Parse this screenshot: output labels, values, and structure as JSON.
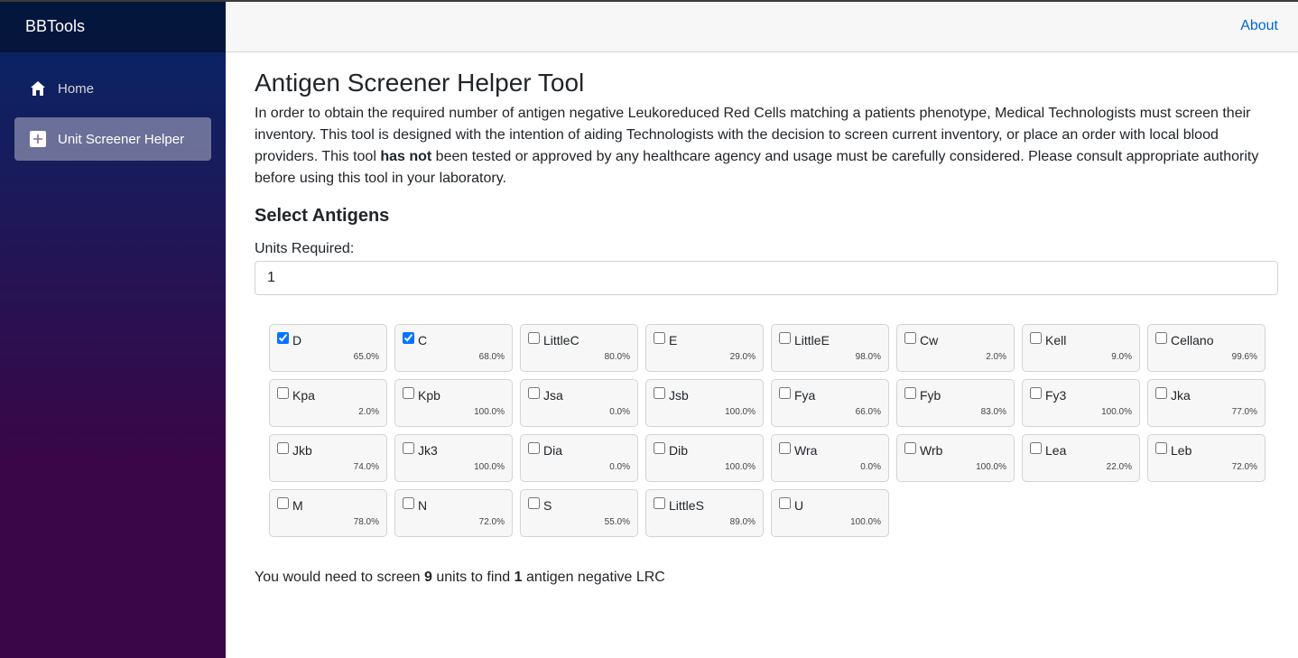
{
  "brand": "BBTools",
  "nav": [
    {
      "label": "Home",
      "icon": "home-icon",
      "active": false
    },
    {
      "label": "Unit Screener Helper",
      "icon": "plus-icon",
      "active": true
    }
  ],
  "topbar": {
    "about": "About"
  },
  "page": {
    "title": "Antigen Screener Helper Tool",
    "intro_before_bold": "In order to obtain the required number of antigen negative Leukoreduced Red Cells matching a patients phenotype, Medical Technologists must screen their inventory. This tool is designed with the intention of aiding Technologists with the decision to screen current inventory, or place an order with local blood providers. This tool ",
    "intro_bold": "has not",
    "intro_after_bold": " been tested or approved by any healthcare agency and usage must be carefully considered. Please consult appropriate authority before using this tool in your laboratory.",
    "section_title": "Select Antigens",
    "units_label": "Units Required:",
    "units_value": "1"
  },
  "antigens": [
    {
      "name": "D",
      "pct": "65.0%",
      "checked": true
    },
    {
      "name": "C",
      "pct": "68.0%",
      "checked": true
    },
    {
      "name": "LittleC",
      "pct": "80.0%",
      "checked": false
    },
    {
      "name": "E",
      "pct": "29.0%",
      "checked": false
    },
    {
      "name": "LittleE",
      "pct": "98.0%",
      "checked": false
    },
    {
      "name": "Cw",
      "pct": "2.0%",
      "checked": false
    },
    {
      "name": "Kell",
      "pct": "9.0%",
      "checked": false
    },
    {
      "name": "Cellano",
      "pct": "99.6%",
      "checked": false
    },
    {
      "name": "Kpa",
      "pct": "2.0%",
      "checked": false
    },
    {
      "name": "Kpb",
      "pct": "100.0%",
      "checked": false
    },
    {
      "name": "Jsa",
      "pct": "0.0%",
      "checked": false
    },
    {
      "name": "Jsb",
      "pct": "100.0%",
      "checked": false
    },
    {
      "name": "Fya",
      "pct": "66.0%",
      "checked": false
    },
    {
      "name": "Fyb",
      "pct": "83.0%",
      "checked": false
    },
    {
      "name": "Fy3",
      "pct": "100.0%",
      "checked": false
    },
    {
      "name": "Jka",
      "pct": "77.0%",
      "checked": false
    },
    {
      "name": "Jkb",
      "pct": "74.0%",
      "checked": false
    },
    {
      "name": "Jk3",
      "pct": "100.0%",
      "checked": false
    },
    {
      "name": "Dia",
      "pct": "0.0%",
      "checked": false
    },
    {
      "name": "Dib",
      "pct": "100.0%",
      "checked": false
    },
    {
      "name": "Wra",
      "pct": "0.0%",
      "checked": false
    },
    {
      "name": "Wrb",
      "pct": "100.0%",
      "checked": false
    },
    {
      "name": "Lea",
      "pct": "22.0%",
      "checked": false
    },
    {
      "name": "Leb",
      "pct": "72.0%",
      "checked": false
    },
    {
      "name": "M",
      "pct": "78.0%",
      "checked": false
    },
    {
      "name": "N",
      "pct": "72.0%",
      "checked": false
    },
    {
      "name": "S",
      "pct": "55.0%",
      "checked": false
    },
    {
      "name": "LittleS",
      "pct": "89.0%",
      "checked": false
    },
    {
      "name": "U",
      "pct": "100.0%",
      "checked": false
    }
  ],
  "result": {
    "prefix": "You would need to screen ",
    "units_to_screen": "9",
    "middle": " units to find ",
    "units_needed": "1",
    "suffix": " antigen negative LRC"
  }
}
